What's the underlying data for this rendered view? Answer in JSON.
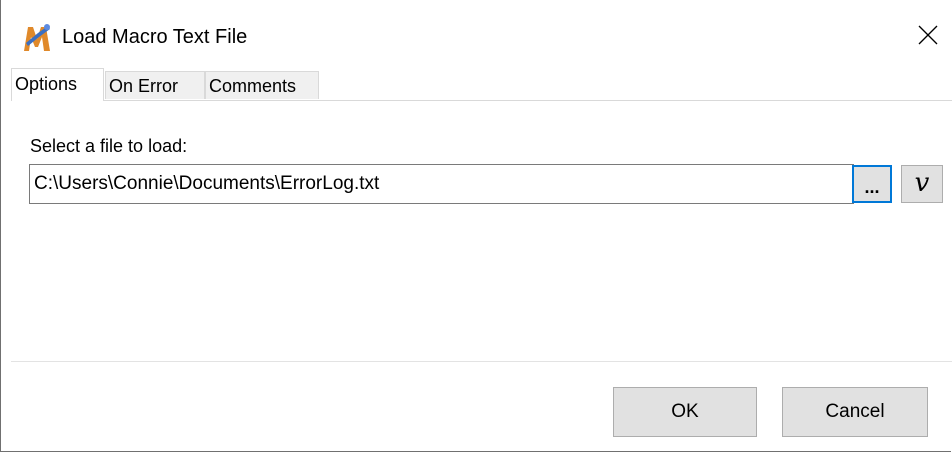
{
  "window": {
    "title": "Load Macro Text File",
    "app_icon": "macro-express-logo-icon",
    "close_icon": "close-icon"
  },
  "tabs": [
    {
      "label": "Options",
      "active": true
    },
    {
      "label": "On Error",
      "active": false
    },
    {
      "label": "Comments",
      "active": false
    }
  ],
  "options": {
    "file_label": "Select a file to load:",
    "file_value": "C:\\Users\\Connie\\Documents\\ErrorLog.txt",
    "browse_label": "...",
    "variable_label": "v"
  },
  "buttons": {
    "ok": "OK",
    "cancel": "Cancel"
  },
  "colors": {
    "focus_border": "#0078d7",
    "button_face": "#e1e1e1"
  }
}
